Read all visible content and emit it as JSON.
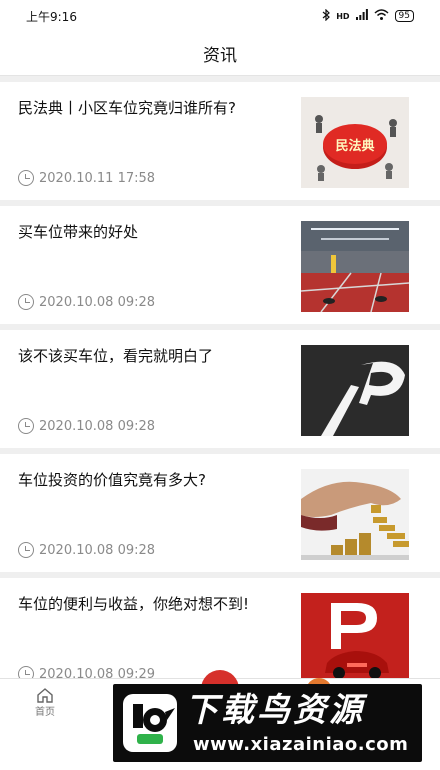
{
  "status_bar": {
    "time": "上午9:16",
    "network": "HD",
    "battery": "95"
  },
  "header": {
    "title": "资讯"
  },
  "articles": [
    {
      "title": "民法典丨小区车位究竟归谁所有?",
      "date": "2020.10.11 17:58",
      "thumb_text": "民法典"
    },
    {
      "title": "买车位带来的好处",
      "date": "2020.10.08 09:28"
    },
    {
      "title": "该不该买车位，看完就明白了",
      "date": "2020.10.08 09:28"
    },
    {
      "title": "车位投资的价值究竟有多大?",
      "date": "2020.10.08 09:28"
    },
    {
      "title": "车位的便利与收益，你绝对想不到!",
      "date": "2020.10.08 09:29"
    }
  ],
  "tabbar": {
    "home_label": "首页"
  },
  "watermark": {
    "title": "下载鸟资源",
    "url": "www.xiazainiao.com"
  },
  "colors": {
    "accent_red": "#d6302b",
    "orange": "#e4792f",
    "date_gray": "#8a8a8a"
  }
}
